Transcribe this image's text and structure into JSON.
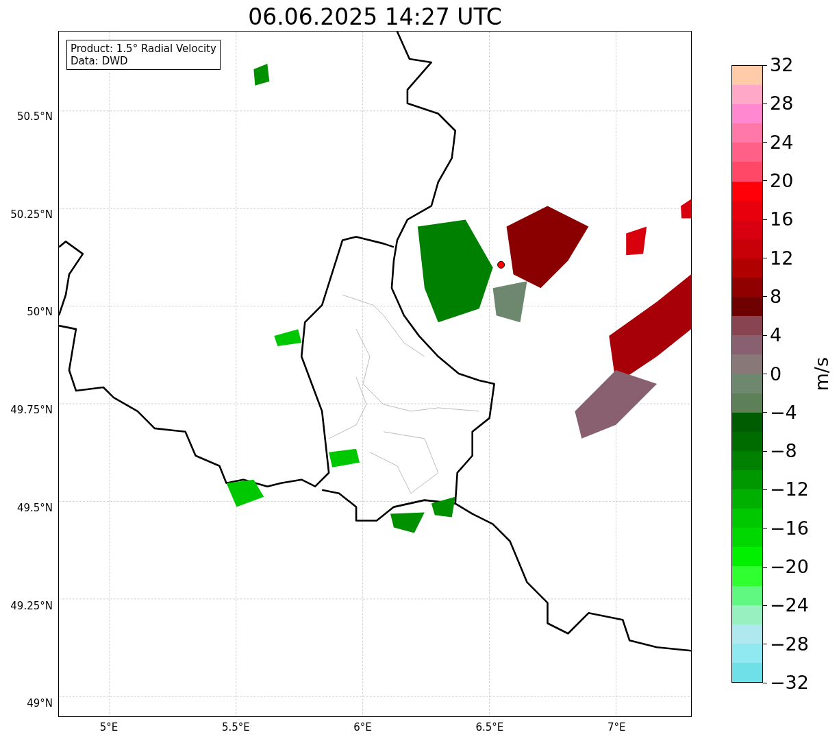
{
  "title": "06.06.2025 14:27 UTC",
  "legend": {
    "lines": [
      "Product: 1.5° Radial Velocity",
      "Data: DWD"
    ]
  },
  "map": {
    "y_ticks": [
      "50.5°N",
      "50.25°N",
      "50°N",
      "49.75°N",
      "49.5°N",
      "49.25°N",
      "49°N"
    ],
    "x_ticks": [
      "5°E",
      "5.5°E",
      "6°E",
      "6.5°E",
      "7°E"
    ]
  },
  "colorbar": {
    "label": "m/s",
    "ticks": [
      "32",
      "28",
      "24",
      "20",
      "16",
      "12",
      "8",
      "4",
      "0",
      "−4",
      "−8",
      "−12",
      "−16",
      "−20",
      "−24",
      "−28",
      "−32"
    ],
    "bands": [
      {
        "color": "#ffcba8"
      },
      {
        "color": "#ffa8c8"
      },
      {
        "color": "#ff88d0"
      },
      {
        "color": "#ff78a8"
      },
      {
        "color": "#ff6088"
      },
      {
        "color": "#ff4868"
      },
      {
        "color": "#ff0008"
      },
      {
        "color": "#e8000c"
      },
      {
        "color": "#d80010"
      },
      {
        "color": "#c80008"
      },
      {
        "color": "#b00000"
      },
      {
        "color": "#900000"
      },
      {
        "color": "#6e0000"
      },
      {
        "color": "#884450"
      },
      {
        "color": "#886070"
      },
      {
        "color": "#887878"
      },
      {
        "color": "#6e8870"
      },
      {
        "color": "#5e8058"
      },
      {
        "color": "#005c00"
      },
      {
        "color": "#006c00"
      },
      {
        "color": "#008000"
      },
      {
        "color": "#009800"
      },
      {
        "color": "#00b000"
      },
      {
        "color": "#00c800"
      },
      {
        "color": "#00d800"
      },
      {
        "color": "#00f000"
      },
      {
        "color": "#30ff30"
      },
      {
        "color": "#60f880"
      },
      {
        "color": "#98f0c0"
      },
      {
        "color": "#b0e8f0"
      },
      {
        "color": "#90e8f0"
      },
      {
        "color": "#70e0e8"
      }
    ]
  }
}
